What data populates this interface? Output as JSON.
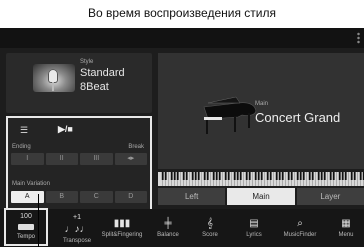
{
  "caption": "Во время воспроизведения стиля",
  "style_panel": {
    "tag": "Style",
    "name": "Standard",
    "sub": "8Beat"
  },
  "controls": {
    "ending_label": "Ending",
    "break_label": "Break",
    "ending_buttons": [
      "I",
      "II",
      "III"
    ],
    "break_glyph": "◂▸",
    "main_variation_label": "Main Variation",
    "variation_buttons": [
      "A",
      "B",
      "C",
      "D"
    ],
    "selected_variation": "A"
  },
  "voice_panel": {
    "tag": "Main",
    "name": "Concert Grand"
  },
  "part_tabs": [
    "Left",
    "Main",
    "Layer"
  ],
  "selected_tab": "Main",
  "tempo": {
    "value": "100",
    "label": "Tempo"
  },
  "bottom_items": [
    {
      "value": "+1",
      "label": "Transpose",
      "icon": "transpose-icon"
    },
    {
      "value": "",
      "label": "Split&Fingering",
      "icon": "split-icon"
    },
    {
      "value": "",
      "label": "Balance",
      "icon": "balance-icon"
    },
    {
      "value": "",
      "label": "Score",
      "icon": "score-icon"
    },
    {
      "value": "",
      "label": "Lyrics",
      "icon": "lyrics-icon"
    },
    {
      "value": "",
      "label": "MusicFinder",
      "icon": "musicfinder-icon"
    },
    {
      "value": "",
      "label": "Menu",
      "icon": "menu-icon"
    }
  ]
}
